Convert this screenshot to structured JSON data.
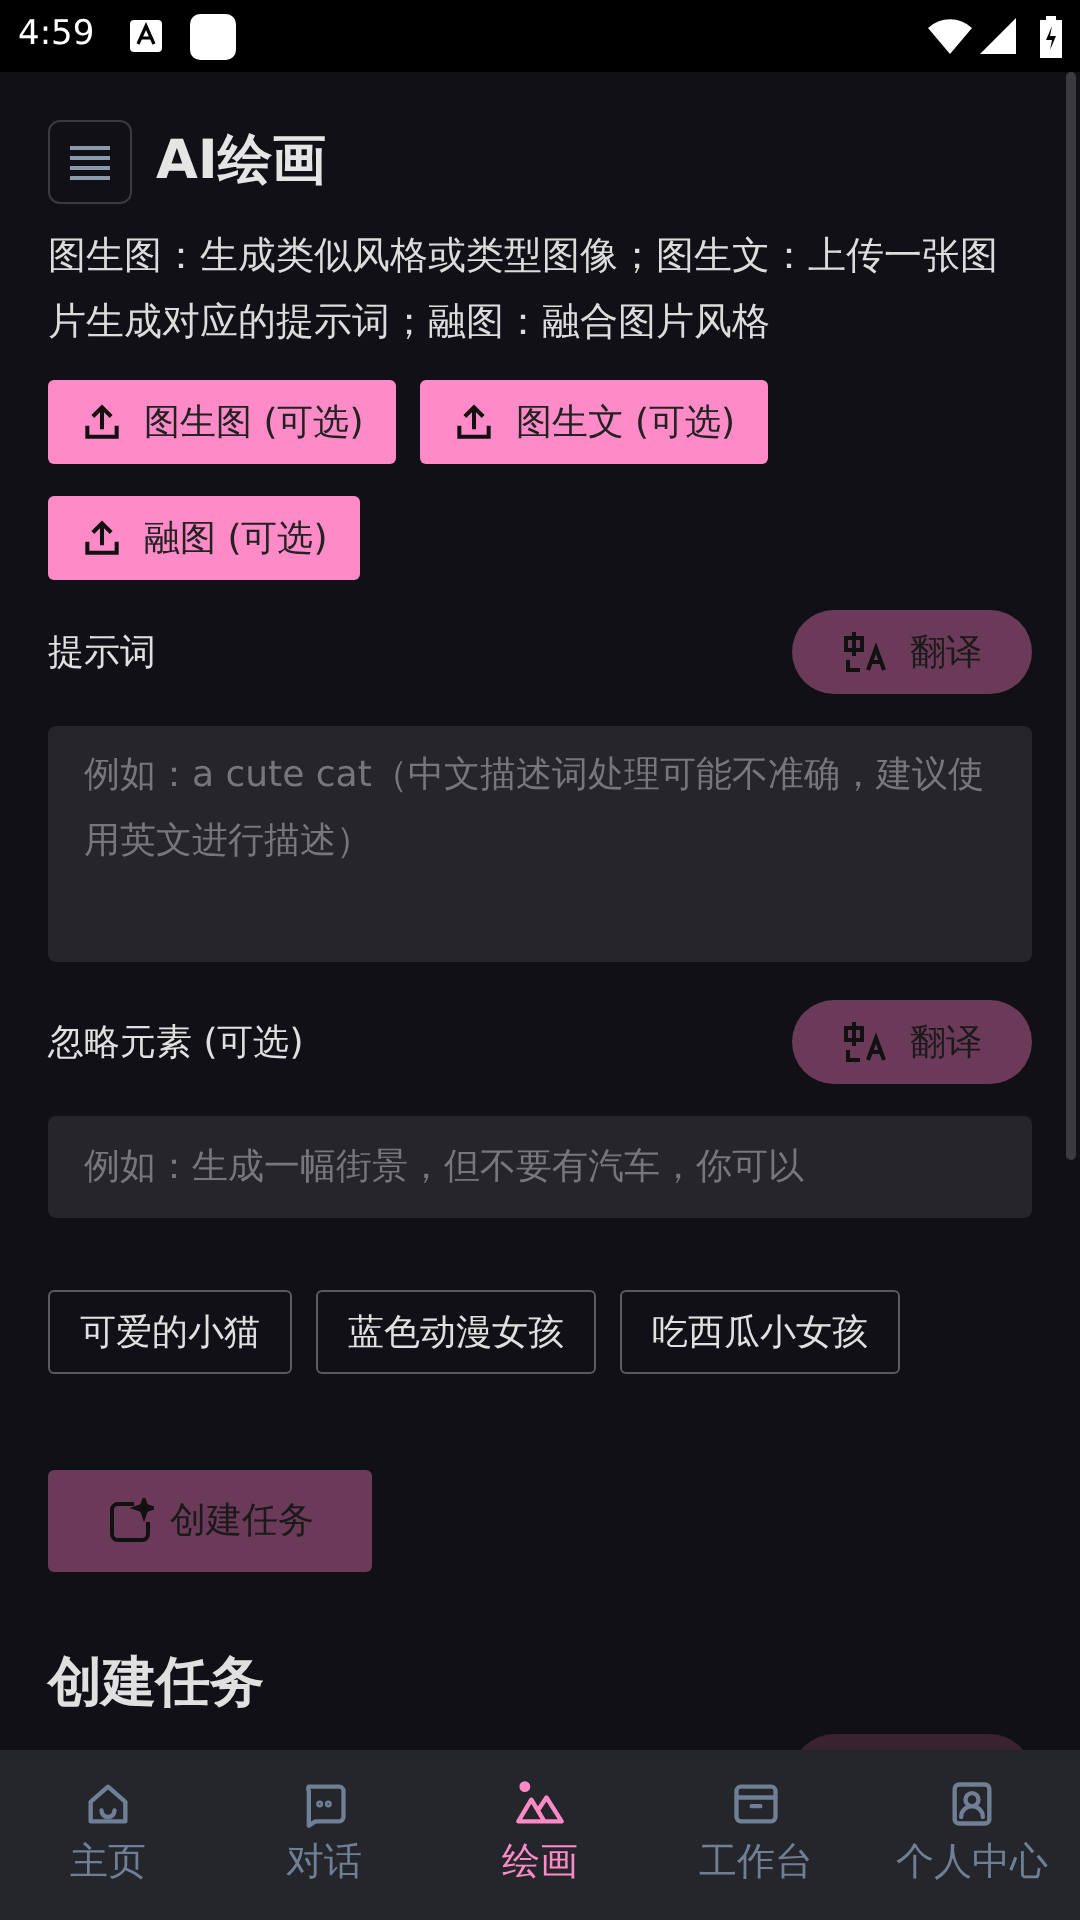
{
  "status_bar": {
    "time": "4:59"
  },
  "header": {
    "title": "AI绘画"
  },
  "description": "图生图：生成类似风格或类型图像；图生文：上传一张图片生成对应的提示词；融图：融合图片风格",
  "upload_buttons": [
    {
      "label": "图生图 (可选)"
    },
    {
      "label": "图生文 (可选)"
    },
    {
      "label": "融图 (可选)"
    }
  ],
  "prompt": {
    "label": "提示词",
    "translate": "翻译",
    "placeholder": "例如：a cute cat（中文描述词处理可能不准确，建议使用英文进行描述）"
  },
  "negative": {
    "label": "忽略元素 (可选)",
    "translate": "翻译",
    "placeholder": "例如：生成一幅街景，但不要有汽车，你可以"
  },
  "presets": [
    "可爱的小猫",
    "蓝色动漫女孩",
    "吃西瓜小女孩"
  ],
  "create_button": {
    "label": "创建任务",
    "disabled": true
  },
  "tasks": {
    "title": "创建任务"
  },
  "bottom_nav": [
    {
      "label": "主页",
      "selected": false
    },
    {
      "label": "对话",
      "selected": false
    },
    {
      "label": "绘画",
      "selected": true
    },
    {
      "label": "工作台",
      "selected": false
    },
    {
      "label": "个人中心",
      "selected": false
    }
  ]
}
